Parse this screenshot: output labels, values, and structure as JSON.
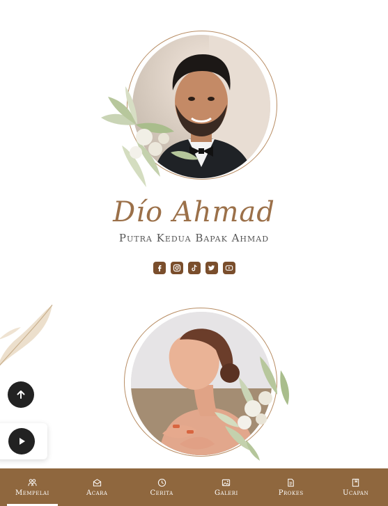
{
  "groom": {
    "name": "Dío Ahmad",
    "subtitle": "Putra Kedua Bapak Ahmad"
  },
  "socials": [
    {
      "icon": "facebook-icon"
    },
    {
      "icon": "instagram-icon"
    },
    {
      "icon": "tiktok-icon"
    },
    {
      "icon": "twitter-icon"
    },
    {
      "icon": "youtube-icon"
    }
  ],
  "nav": {
    "items": [
      {
        "label": "Mempelai",
        "icon": "couple-icon",
        "active": true
      },
      {
        "label": "Acara",
        "icon": "envelope-icon",
        "active": false
      },
      {
        "label": "Cerita",
        "icon": "clock-icon",
        "active": false
      },
      {
        "label": "Galeri",
        "icon": "gallery-icon",
        "active": false
      },
      {
        "label": "Prokes",
        "icon": "document-icon",
        "active": false
      },
      {
        "label": "Ucapan",
        "icon": "book-icon",
        "active": false
      }
    ]
  },
  "colors": {
    "accent": "#9b7049",
    "nav_bg": "#8f673e",
    "social_bg": "#7a4e2c",
    "fab_bg": "#222222"
  }
}
